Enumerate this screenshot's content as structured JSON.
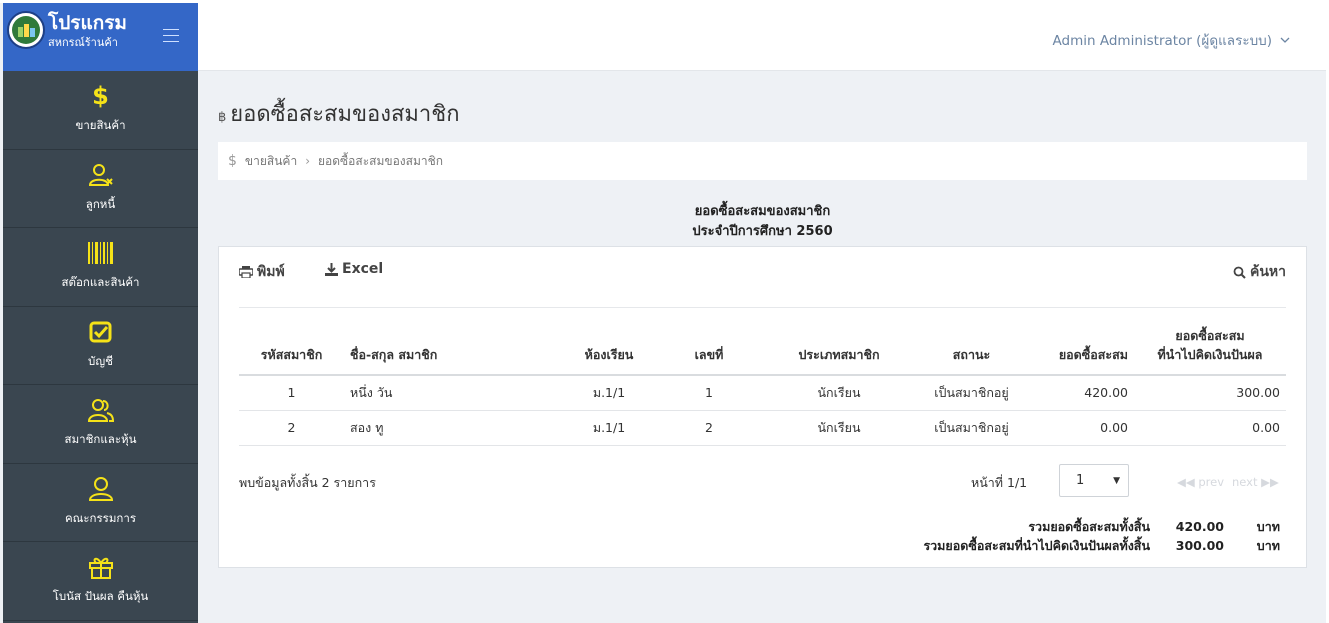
{
  "app": {
    "title": "โปรแกรม",
    "subtitle": "สหกรณ์ร้านค้า"
  },
  "user": {
    "name": "Admin Administrator (ผู้ดูแลระบบ)"
  },
  "sidebar": {
    "items": [
      {
        "label": "ขายสินค้า",
        "icon": "dollar-icon"
      },
      {
        "label": "ลูกหนี้",
        "icon": "user-x-icon"
      },
      {
        "label": "สต๊อกและสินค้า",
        "icon": "barcode-icon"
      },
      {
        "label": "บัญชี",
        "icon": "checkbox-icon"
      },
      {
        "label": "สมาชิกและหุ้น",
        "icon": "users-icon"
      },
      {
        "label": "คณะกรรมการ",
        "icon": "user-icon"
      },
      {
        "label": "โบนัส ปันผล คืนหุ้น",
        "icon": "gift-icon"
      }
    ]
  },
  "page": {
    "title": "ยอดซื้อสะสมของสมาชิก",
    "currency_symbol": "฿"
  },
  "breadcrumb": {
    "items": [
      "ขายสินค้า",
      "ยอดซื้อสะสมของสมาชิก"
    ]
  },
  "report": {
    "heading": "ยอดซื้อสะสมของสมาชิก",
    "subheading": "ประจำปีการศึกษา 2560"
  },
  "toolbar": {
    "print_label": "พิมพ์",
    "excel_label": "Excel",
    "search_label": "ค้นหา"
  },
  "table": {
    "columns": [
      "รหัสสมาชิก",
      "ชื่อ-สกุล สมาชิก",
      "ห้องเรียน",
      "เลขที่",
      "ประเภทสมาชิก",
      "สถานะ",
      "ยอดซื้อสะสม",
      "ยอดซื้อสะสม",
      "ที่นำไปคิดเงินปันผล"
    ],
    "rows": [
      {
        "id": "1",
        "name": "หนึ่ง วัน",
        "room": "ม.1/1",
        "no": "1",
        "type": "นักเรียน",
        "status": "เป็นสมาชิกอยู่",
        "total": "420.00",
        "dividend": "300.00"
      },
      {
        "id": "2",
        "name": "สอง ทู",
        "room": "ม.1/1",
        "no": "2",
        "type": "นักเรียน",
        "status": "เป็นสมาชิกอยู่",
        "total": "0.00",
        "dividend": "0.00"
      }
    ]
  },
  "footer": {
    "found_text": "พบข้อมูลทั้งสิ้น 2 รายการ",
    "page_text": "หน้าที่ 1/1",
    "page_select": "1",
    "prev_label": "◀◀ prev",
    "next_label": "next ▶▶"
  },
  "totals": {
    "sum_label": "รวมยอดซื้อสะสมทั้งสิ้น",
    "sum_value": "420.00",
    "dividend_label": "รวมยอดซื้อสะสมที่นำไปคิดเงินปันผลทั้งสิ้น",
    "dividend_value": "300.00",
    "unit": "บาท"
  },
  "colors": {
    "brand": "#3467c7",
    "sidebar": "#3a4650",
    "icon_accent": "#f5e218"
  }
}
